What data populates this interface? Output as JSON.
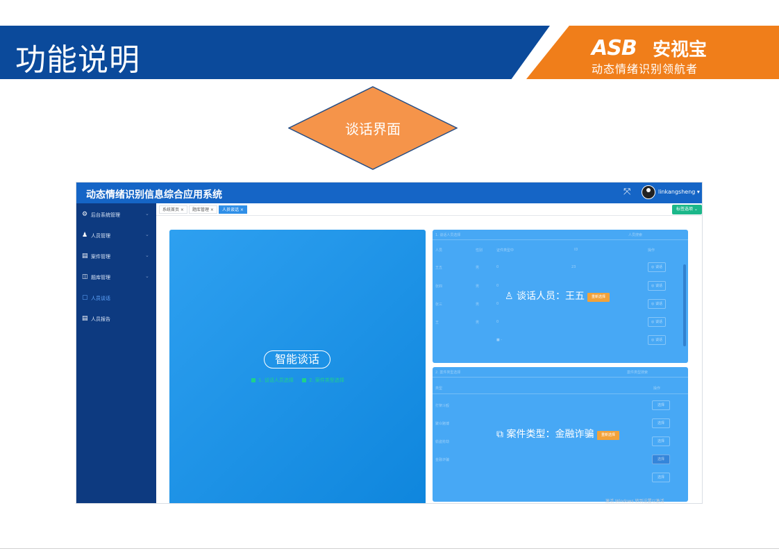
{
  "slide": {
    "title": "功能说明",
    "logo": {
      "mark": "ASB",
      "name": "安视宝",
      "slogan": "动态情绪识别领航者"
    },
    "diamond_label": "谈话界面",
    "colors": {
      "header_blue": "#0b4a9b",
      "header_orange": "#f07e1a",
      "diamond_fill": "#f5944a",
      "diamond_stroke": "#274f86"
    }
  },
  "app": {
    "title": "动态情绪识别信息综合应用系统",
    "expand_icon": "⤧",
    "username": "linkangsheng ▾",
    "sidebar": {
      "items": [
        {
          "icon": "⚙",
          "label": "后台系统管理",
          "chevron": "⌄"
        },
        {
          "icon": "♟",
          "label": "人员管理",
          "chevron": "⌄"
        },
        {
          "icon": "▤",
          "label": "案件管理",
          "chevron": "⌄"
        },
        {
          "icon": "◫",
          "label": "题库管理",
          "chevron": "⌄"
        },
        {
          "icon": "▢",
          "label": "人员谈话",
          "chevron": ""
        },
        {
          "icon": "▤",
          "label": "人员报告",
          "chevron": ""
        }
      ]
    },
    "tabs": [
      {
        "label": "系统首页 ×"
      },
      {
        "label": "题库管理 ×"
      },
      {
        "label": "人员谈话 ×"
      }
    ],
    "tab_close_label": "标签选项 ⌄",
    "left_panel": {
      "button": "智能谈话",
      "hint1": "1. 谈话人员选择",
      "hint2": "2. 案件类型选择"
    },
    "right_top": {
      "header": "1. 谈话人员选择",
      "search": "人员搜索",
      "columns": [
        "人员",
        "性别",
        "证件类型中",
        "ID",
        "操作"
      ],
      "rows": [
        {
          "name": "王五",
          "sex": "男",
          "type": "0",
          "id": "23",
          "op": "◎ 谈话"
        },
        {
          "name": "张四",
          "sex": "男",
          "type": "0",
          "id": "",
          "op": "◎ 谈话"
        },
        {
          "name": "张三",
          "sex": "男",
          "type": "0",
          "id": "",
          "op": "◎ 谈话"
        },
        {
          "name": "王",
          "sex": "男",
          "type": "0",
          "id": "",
          "op": "◎ 谈话"
        },
        {
          "name": "",
          "sex": "",
          "type": "■ -",
          "id": "",
          "op": "◎ 谈话"
        }
      ],
      "selected_prefix": "谈话人员：",
      "selected_value": "王五",
      "reselect": "重新选择"
    },
    "right_bottom": {
      "header": "2. 案件类型选择",
      "search": "案件类型搜索",
      "columns": [
        "类型",
        "操作"
      ],
      "rows": [
        {
          "name": "打架斗殴",
          "op": "选择"
        },
        {
          "name": "聚众赌博",
          "op": "选择"
        },
        {
          "name": "偷盗抢劫",
          "op": "选择"
        },
        {
          "name": "金融诈骗",
          "op": "选择"
        },
        {
          "name": "",
          "op": "选择"
        }
      ],
      "selected_prefix": "案件类型：",
      "selected_value": "金融诈骗",
      "reselect": "重新选择"
    },
    "watermark": "激活 Windows 转到设置以激活"
  }
}
